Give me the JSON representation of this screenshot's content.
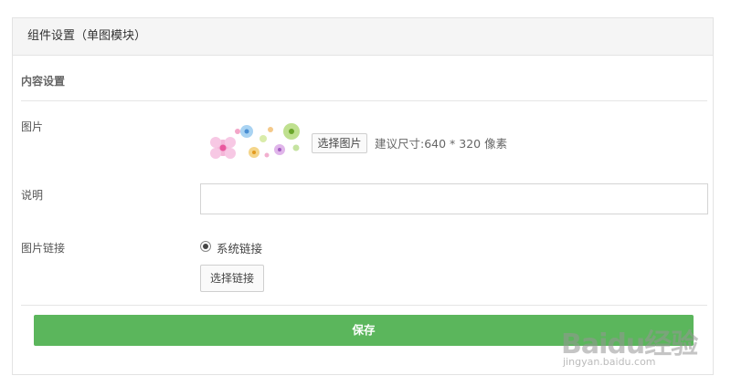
{
  "panel": {
    "title": "组件设置（单图模块）"
  },
  "content": {
    "section_title": "内容设置",
    "image": {
      "label": "图片",
      "select_button": "选择图片",
      "size_hint": "建议尺寸:640 * 320 像素"
    },
    "description": {
      "label": "说明",
      "value": "",
      "placeholder": ""
    },
    "image_link": {
      "label": "图片链接",
      "radio_label": "系统链接",
      "radio_checked": true,
      "select_button": "选择链接"
    }
  },
  "actions": {
    "save_label": "保存"
  },
  "watermark": {
    "brand": "Baidu经验",
    "url": "jingyan.baidu.com"
  },
  "colors": {
    "save": "#5bb65c",
    "border": "#e3e3e3",
    "header_bg": "#f5f5f5"
  }
}
